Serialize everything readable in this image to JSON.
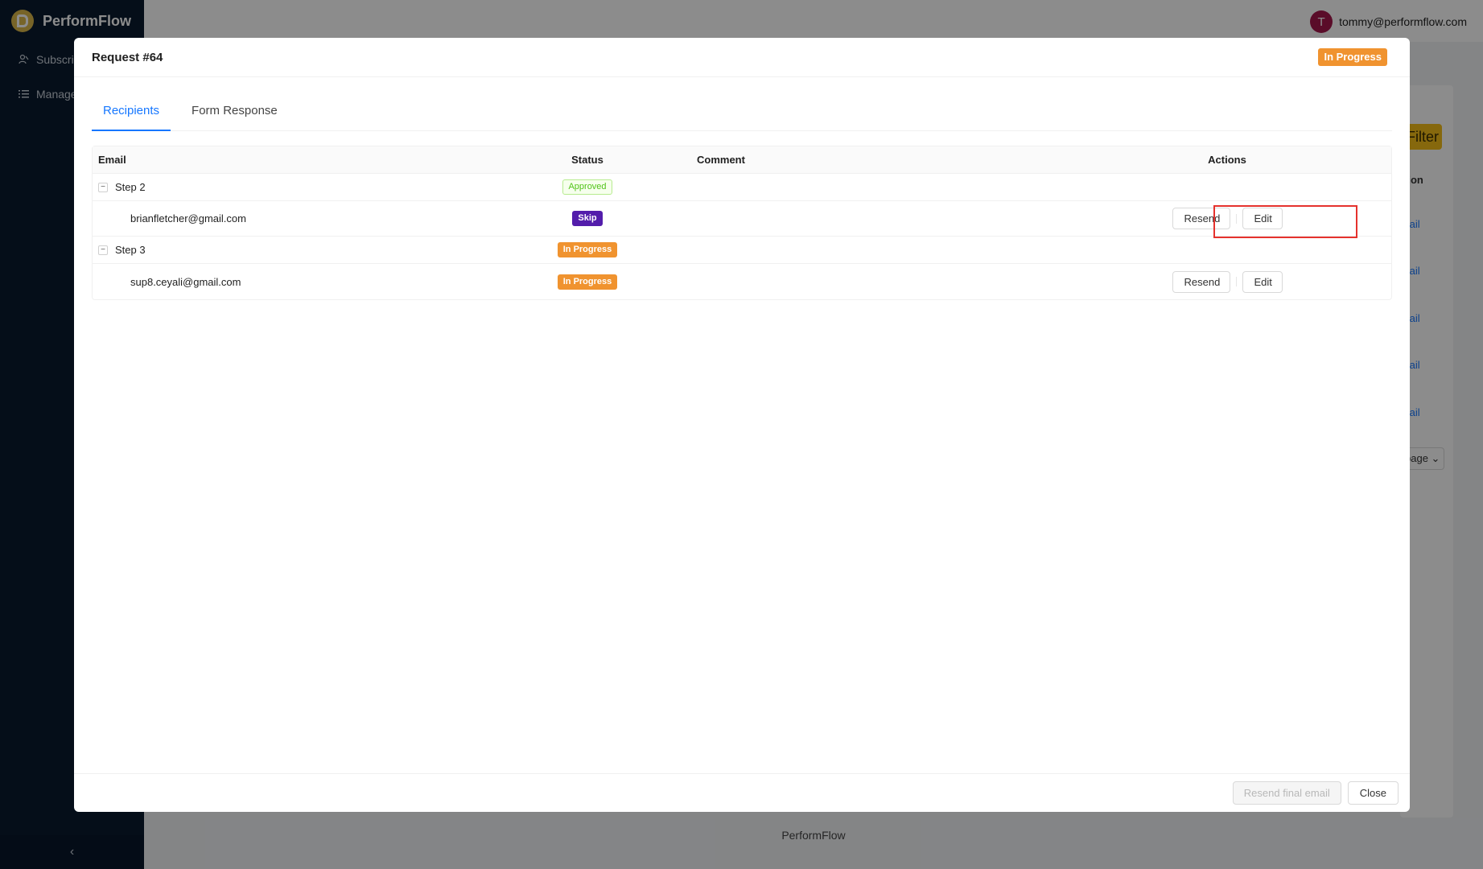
{
  "app": {
    "brand": "PerformFlow",
    "nav": [
      {
        "label": "Subscrip",
        "icon": "users-icon"
      },
      {
        "label": "Manage",
        "icon": "list-icon"
      }
    ],
    "collapse_glyph": "‹",
    "user": {
      "initial": "T",
      "email": "tommy@performflow.com"
    },
    "bg_filter": "Filter",
    "bg_col_header": "tion",
    "bg_detail_link": "tail",
    "bg_pagesize": "page",
    "footer": "PerformFlow"
  },
  "modal": {
    "title": "Request #64",
    "status": "In Progress",
    "tabs": [
      {
        "label": "Recipients",
        "active": true
      },
      {
        "label": "Form Response",
        "active": false
      }
    ],
    "table": {
      "headers": {
        "email": "Email",
        "status": "Status",
        "comment": "Comment",
        "actions": "Actions"
      },
      "groups": [
        {
          "step": "Step 2",
          "status": "Approved",
          "recipients": [
            {
              "email": "brianfletcher@gmail.com",
              "status": "Skip",
              "comment": "",
              "resend": "Resend",
              "edit": "Edit"
            }
          ]
        },
        {
          "step": "Step 3",
          "status": "In Progress",
          "recipients": [
            {
              "email": "sup8.ceyali@gmail.com",
              "status": "In Progress",
              "comment": "",
              "resend": "Resend",
              "edit": "Edit"
            }
          ]
        }
      ]
    },
    "footer": {
      "resend_final": "Resend final email",
      "close": "Close"
    }
  },
  "colors": {
    "primary": "#1677ff",
    "in_progress": "#f0932f",
    "skip": "#531dab",
    "approved": "#52c41a",
    "highlight": "#e5322d",
    "sidebar": "#0a1a2e"
  }
}
